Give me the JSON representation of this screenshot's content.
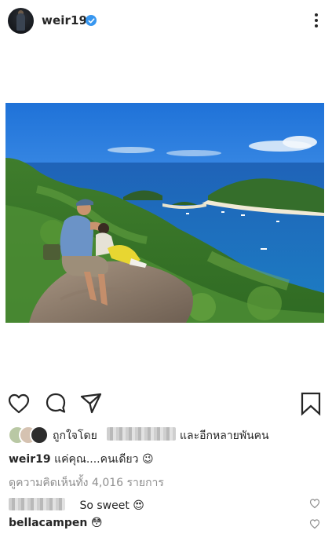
{
  "post": {
    "username": "weir19",
    "verified": true
  },
  "actions": {
    "like": "heart-icon",
    "comment": "comment-icon",
    "share": "paper-plane-icon",
    "save": "bookmark-icon"
  },
  "likes": {
    "prefix": "ถูกใจโดย",
    "suffix": "และอีกหลายพันคน"
  },
  "caption": {
    "username": "weir19",
    "text": "แค่คุณ....คนเดียว",
    "emoji": "😉"
  },
  "view_comments": "ดูความคิดเห็นทั้ง 4,016 รายการ",
  "comments": [
    {
      "username": "",
      "text": "So sweet",
      "emoji": "😍"
    },
    {
      "username": "bellacampen",
      "text": "",
      "emoji": "😳"
    }
  ],
  "colors": {
    "text": "#262626",
    "muted": "#8e8e8e",
    "verified": "#3897f0"
  }
}
